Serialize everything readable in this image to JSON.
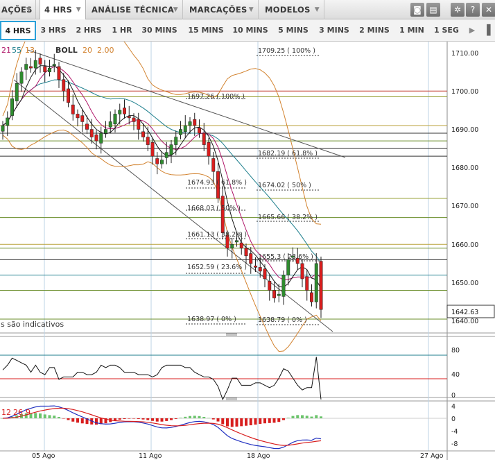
{
  "menubar": {
    "items": [
      {
        "label": "AÇÕES",
        "active": false
      },
      {
        "label": "4 HRS",
        "active": true
      },
      {
        "label": "ANÁLISE TÉCNICA",
        "active": false
      },
      {
        "label": "MARCAÇÕES",
        "active": false
      },
      {
        "label": "MODELOS",
        "active": false
      }
    ],
    "icons": [
      "camera-icon",
      "print-icon",
      "gear-icon",
      "help-icon",
      "close-icon"
    ]
  },
  "timeframes": {
    "items": [
      "4 HRS",
      "3 HRS",
      "2 HRS",
      "1 HR",
      "30 MINS",
      "15 MINS",
      "10 MINS",
      "5 MINS",
      "3 MINS",
      "2 MINS",
      "1 MIN",
      "1 SEG"
    ],
    "selected": "4 HRS"
  },
  "indicators": {
    "ma_periods": [
      "21",
      "55",
      "13"
    ],
    "boll_label": "BOLL",
    "boll_params": [
      "20",
      "2.00"
    ],
    "macd_params": [
      "12",
      "26",
      "9"
    ],
    "disclaimer": "s são indicativos"
  },
  "price_axis": {
    "ticks": [
      "1710.00",
      "1700.00",
      "1690.00",
      "1680.00",
      "1670.00",
      "1660.00",
      "1650.00",
      "1640.00"
    ],
    "last_price": "1642.63"
  },
  "rsi_axis": {
    "ticks": [
      "80",
      "40",
      "0"
    ]
  },
  "macd_axis": {
    "ticks": [
      "4",
      "0",
      "-4",
      "-8"
    ]
  },
  "date_axis": {
    "labels": [
      "05 Ago",
      "11 Ago",
      "18 Ago",
      "27 Ago"
    ]
  },
  "fib_labels": {
    "set1": [
      "1697.26 ( 100% )",
      "1674.93 ( 61.8% )",
      "1668.03 ( 50% )",
      "1661.13 ( 38.2% )",
      "1652.59 ( 23.6% )",
      "1638.97 ( 0% )"
    ],
    "set2": [
      "1709.25 ( 100% )",
      "1682.19 ( 61.8% )",
      "1674.02 ( 50% )",
      "1665.66 ( 38.2% )",
      "1655.3 ( 23.6% )",
      "1638.79 ( 0% )"
    ]
  },
  "colors": {
    "accent": "#2aa0d8",
    "up_candle": "#2e8b2e",
    "down_candle": "#d81e1e",
    "boll": "#d2822e",
    "ma_black": "#1a1a1a",
    "ma_magenta": "#b0186a",
    "ma_teal": "#1c7e8c",
    "macd_blue": "#2030c0",
    "macd_red": "#d81e1e"
  },
  "chart_data": {
    "type": "line",
    "subtype": "candlestick",
    "ylim": [
      1638,
      1712
    ],
    "yticks": [
      1710,
      1700,
      1690,
      1680,
      1670,
      1660,
      1650,
      1640
    ],
    "series": [
      {
        "name": "Close",
        "values": [
          1691,
          1693,
          1698,
          1702,
          1705,
          1707,
          1706,
          1708,
          1707,
          1705,
          1706,
          1707,
          1703,
          1700,
          1697,
          1694,
          1693,
          1692,
          1690,
          1688,
          1687,
          1689,
          1690,
          1692,
          1694,
          1695,
          1694,
          1693,
          1692,
          1690,
          1688,
          1686,
          1683,
          1681,
          1682,
          1684,
          1686,
          1688,
          1690,
          1691,
          1692,
          1691,
          1689,
          1686,
          1683,
          1679,
          1672,
          1663,
          1659,
          1660,
          1661,
          1659,
          1657,
          1655,
          1654,
          1653,
          1651,
          1648,
          1646,
          1647,
          1652,
          1656,
          1657,
          1655,
          1651,
          1648,
          1645,
          1655,
          1643
        ]
      }
    ],
    "rsi": {
      "ylim": [
        0,
        100
      ],
      "levels": [
        80,
        40
      ]
    },
    "macd": {
      "ylim": [
        -8,
        6
      ],
      "params": [
        12,
        26,
        9
      ]
    }
  }
}
